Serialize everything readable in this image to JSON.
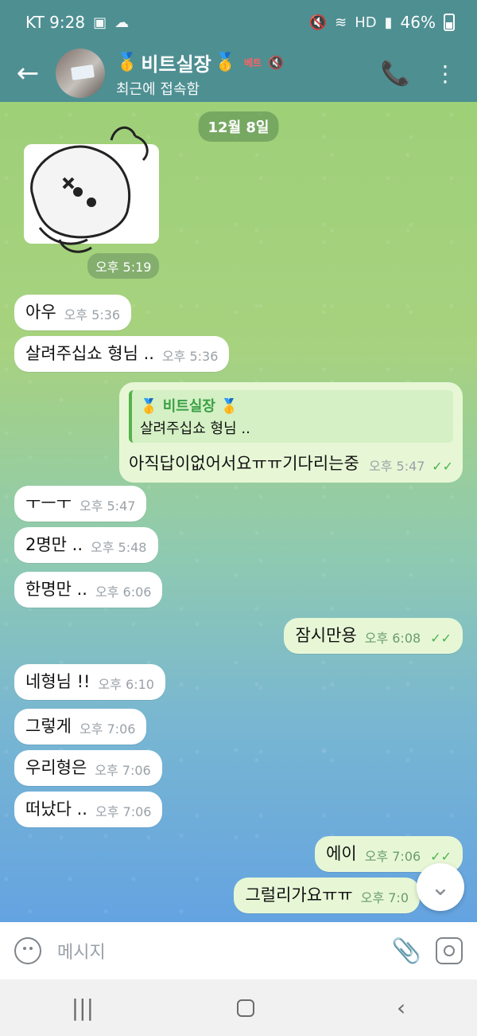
{
  "status_bar": {
    "carrier_time": "KT 9:28",
    "battery": "46%",
    "icons": [
      "gallery-icon",
      "cloud-icon",
      "mute-icon",
      "wifi-icon",
      "hd-icon",
      "signal-icon"
    ]
  },
  "header": {
    "title": "비트실장",
    "subtitle": "최근에 접속함",
    "badge": "베트",
    "back_icon": "back-arrow-icon",
    "call_icon": "phone-icon",
    "menu_icon": "more-vert-icon"
  },
  "chat": {
    "date_chip": "12월 8일",
    "sticker_time": "오후 5:19",
    "messages": [
      {
        "dir": "in",
        "text": "아우",
        "time": "오후 5:36"
      },
      {
        "dir": "in",
        "text": "살려주십쇼 형님 ..",
        "time": "오후 5:36"
      },
      {
        "dir": "out",
        "quote_name": "비트실장",
        "quote_text": "살려주십쇼 형님 ..",
        "text": "아직답이없어서요ㅠㅠ기다리는중",
        "time": "오후 5:47"
      },
      {
        "dir": "in",
        "text": "ㅜㅡㅜ",
        "time": "오후 5:47"
      },
      {
        "dir": "in",
        "text": "2명만 ..",
        "time": "오후 5:48"
      },
      {
        "dir": "in",
        "text": "한명만 ..",
        "time": "오후 6:06"
      },
      {
        "dir": "out",
        "text": "잠시만용",
        "time": "오후 6:08"
      },
      {
        "dir": "in",
        "text": "네형님 !!",
        "time": "오후 6:10"
      },
      {
        "dir": "in",
        "text": "그렇게",
        "time": "오후 7:06"
      },
      {
        "dir": "in",
        "text": "우리형은",
        "time": "오후 7:06"
      },
      {
        "dir": "in",
        "text": "떠났다 ..",
        "time": "오후 7:06"
      },
      {
        "dir": "out",
        "text": "에이",
        "time": "오후 7:06"
      },
      {
        "dir": "out",
        "text": "그럴리가요ㅠㅠ",
        "time": "오후 7:0"
      }
    ]
  },
  "input": {
    "placeholder": "메시지"
  }
}
